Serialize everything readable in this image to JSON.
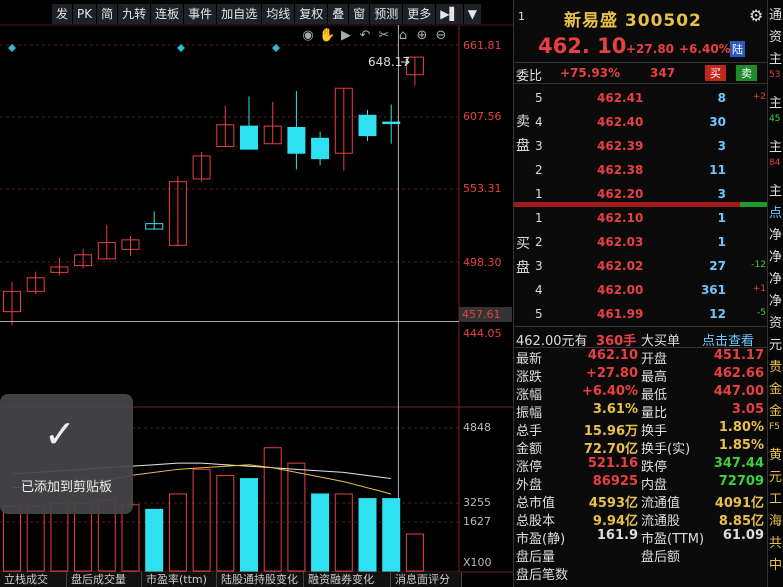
{
  "toolbar": {
    "items": [
      "发",
      "PK",
      "简",
      "九转",
      "连板",
      "事件",
      "加自选",
      "均线",
      "复权",
      "叠",
      "窗",
      "预测",
      "更多",
      "▶▌",
      "▼"
    ]
  },
  "chart_icons": [
    "eye-icon",
    "hand-icon",
    "play-icon",
    "undo-icon",
    "scissors-icon",
    "lock-icon",
    "zoom-in-icon",
    "zoom-out-icon"
  ],
  "chart_data": [
    {
      "type": "candlestick",
      "y_ticks": [
        "661.81",
        "607.56",
        "553.31",
        "498.30",
        "444.05"
      ],
      "ylim": [
        435.2,
        673.0
      ],
      "annotations": {
        "high_label": "648.17",
        "current_price_label": "457.61"
      },
      "up_color": "#e84040",
      "down_color": "#2ee0f0",
      "candles": [
        {
          "o": 465.0,
          "h": 487.0,
          "l": 455.0,
          "c": 480.0
        },
        {
          "o": 480.0,
          "h": 494.5,
          "l": 478.0,
          "c": 490.0
        },
        {
          "o": 494.0,
          "h": 505.0,
          "l": 492.0,
          "c": 498.0
        },
        {
          "o": 499.0,
          "h": 511.5,
          "l": 497.0,
          "c": 507.0
        },
        {
          "o": 504.0,
          "h": 529.0,
          "l": 504.0,
          "c": 516.0
        },
        {
          "o": 511.0,
          "h": 521.0,
          "l": 506.0,
          "c": 518.0
        },
        {
          "o": 530.0,
          "h": 539.0,
          "l": 527.0,
          "c": 526.0
        },
        {
          "o": 514.0,
          "h": 565.0,
          "l": 513.0,
          "c": 561.0
        },
        {
          "o": 563.0,
          "h": 583.0,
          "l": 561.0,
          "c": 580.0
        },
        {
          "o": 587.0,
          "h": 617.0,
          "l": 587.0,
          "c": 603.0
        },
        {
          "o": 602.0,
          "h": 624.0,
          "l": 593.0,
          "c": 585.0
        },
        {
          "o": 589.0,
          "h": 620.0,
          "l": 589.0,
          "c": 602.0
        },
        {
          "o": 601.0,
          "h": 628.0,
          "l": 570.0,
          "c": 582.0
        },
        {
          "o": 593.0,
          "h": 598.0,
          "l": 573.0,
          "c": 578.0
        },
        {
          "o": 582.0,
          "h": 588.0,
          "l": 569.0,
          "c": 630.0
        },
        {
          "o": 610.0,
          "h": 614.0,
          "l": 591.0,
          "c": 595.0
        },
        {
          "o": 605.0,
          "h": 618.0,
          "l": 589.0,
          "c": 604.0
        },
        {
          "o": 640.0,
          "h": 649.0,
          "l": 632.0,
          "c": 653.0
        }
      ],
      "candle_fill": [
        false,
        false,
        false,
        false,
        false,
        false,
        false,
        false,
        false,
        false,
        true,
        false,
        true,
        true,
        false,
        true,
        true,
        false
      ]
    },
    {
      "type": "bar",
      "y_ticks": [
        "4848",
        "3255",
        "1627"
      ],
      "x_tick": "X100",
      "ylim": [
        0,
        5225
      ],
      "values": [
        2100,
        2100,
        2200,
        2200,
        2300,
        2150,
        2000,
        2500,
        3300,
        3100,
        3000,
        4000,
        3500,
        2500,
        2500,
        2350,
        2350,
        1200
      ],
      "colors": [
        "#e84040",
        "#e84040",
        "#e84040",
        "#e84040",
        "#e84040",
        "#e84040",
        "#2ee0f0",
        "#e84040",
        "#e84040",
        "#e84040",
        "#2ee0f0",
        "#e84040",
        "#e84040",
        "#2ee0f0",
        "#e84040",
        "#2ee0f0",
        "#2ee0f0",
        "#e84040"
      ],
      "bar_fill": [
        false,
        false,
        false,
        false,
        false,
        false,
        true,
        false,
        false,
        false,
        true,
        false,
        false,
        true,
        false,
        true,
        true,
        false
      ],
      "ma_white": [
        3150,
        3200,
        3250,
        3300,
        3350,
        3400,
        3450,
        3500,
        3500,
        3450,
        3400,
        3350,
        3300,
        3250,
        3200,
        3100,
        3000
      ],
      "ma_yellow": [
        2700,
        2750,
        2800,
        2850,
        2950,
        3100,
        3200,
        3300,
        3350,
        3400,
        3450,
        3350,
        3200,
        3050,
        2900,
        2700,
        2500
      ]
    }
  ],
  "bottom_tabs": [
    "立栈成交",
    "盘后成交量",
    "市盈率(ttm)",
    "陆股通持股变化",
    "融资融券变化",
    "消息面评分"
  ],
  "toast": {
    "message": "已添加到剪贴板"
  },
  "stock": {
    "name": "新易盛 300502",
    "index_mark": "1",
    "price": "462. 10",
    "change": "+27.80",
    "change_pct": "+6.40%",
    "flag": "陆"
  },
  "weibi": {
    "label": "委比",
    "value": "+75.93%",
    "diff": "347",
    "buy": "买",
    "sell": "卖"
  },
  "sell_label": [
    "卖",
    "盘"
  ],
  "buy_label": [
    "买",
    "盘"
  ],
  "asks": [
    {
      "level": "5",
      "price": "462.41",
      "vol": "8",
      "chg": "+2",
      "chg_color": "#e84040"
    },
    {
      "level": "4",
      "price": "462.40",
      "vol": "30",
      "chg": "",
      "chg_color": "#e84040"
    },
    {
      "level": "3",
      "price": "462.39",
      "vol": "3",
      "chg": "",
      "chg_color": "#e84040"
    },
    {
      "level": "2",
      "price": "462.38",
      "vol": "11",
      "chg": "",
      "chg_color": "#e84040"
    },
    {
      "level": "1",
      "price": "462.20",
      "vol": "3",
      "chg": "",
      "chg_color": "#e84040"
    }
  ],
  "bids": [
    {
      "level": "1",
      "price": "462.10",
      "vol": "1",
      "chg": "",
      "chg_color": "#e84040"
    },
    {
      "level": "2",
      "price": "462.03",
      "vol": "1",
      "chg": "",
      "chg_color": "#e84040"
    },
    {
      "level": "3",
      "price": "462.02",
      "vol": "27",
      "chg": "-12",
      "chg_color": "#3dd13d"
    },
    {
      "level": "4",
      "price": "462.00",
      "vol": "361",
      "chg": "+1",
      "chg_color": "#e84040"
    },
    {
      "level": "5",
      "price": "461.99",
      "vol": "12",
      "chg": "-5",
      "chg_color": "#3dd13d"
    }
  ],
  "last_trade": {
    "price": "462.00元有",
    "vol": "360手",
    "type": "大买单",
    "link": "点击查看"
  },
  "stats": [
    {
      "l1": "最新",
      "v1": "462.10",
      "c1": "#e84040",
      "l2": "开盘",
      "v2": "451.17",
      "c2": "#e84040"
    },
    {
      "l1": "涨跌",
      "v1": "+27.80",
      "c1": "#e84040",
      "l2": "最高",
      "v2": "462.66",
      "c2": "#e84040"
    },
    {
      "l1": "涨幅",
      "v1": "+6.40%",
      "c1": "#e84040",
      "l2": "最低",
      "v2": "447.00",
      "c2": "#e84040"
    },
    {
      "l1": "振幅",
      "v1": "3.61%",
      "c1": "#e8c04a",
      "l2": "量比",
      "v2": "3.05",
      "c2": "#e84040"
    },
    {
      "l1": "总手",
      "v1": "15.96万",
      "c1": "#e8c04a",
      "l2": "换手",
      "v2": "1.80%",
      "c2": "#e8c04a"
    },
    {
      "l1": "金额",
      "v1": "72.70亿",
      "c1": "#e8c04a",
      "l2": "换手(实)",
      "v2": "1.85%",
      "c2": "#e8c04a"
    },
    {
      "l1": "涨停",
      "v1": "521.16",
      "c1": "#e84040",
      "l2": "跌停",
      "v2": "347.44",
      "c2": "#3dd13d"
    },
    {
      "l1": "外盘",
      "v1": "86925",
      "c1": "#e84040",
      "l2": "内盘",
      "v2": "72709",
      "c2": "#3dd13d"
    },
    {
      "l1": "总市值",
      "v1": "4593亿",
      "c1": "#e8c04a",
      "l2": "流通值",
      "v2": "4091亿",
      "c2": "#e8c04a"
    },
    {
      "l1": "总股本",
      "v1": "9.94亿",
      "c1": "#e8c04a",
      "l2": "流通股",
      "v2": "8.85亿",
      "c2": "#e8c04a"
    },
    {
      "l1": "市盈(静)",
      "v1": "161.9",
      "c1": "#dddddd",
      "l2": "市盈(TTM)",
      "v2": "61.09",
      "c2": "#dddddd"
    },
    {
      "l1": "盘后量",
      "v1": "",
      "c1": "#dddddd",
      "l2": "盘后额",
      "v2": "",
      "c2": "#dddddd"
    },
    {
      "l1": "盘后笔数",
      "v1": "",
      "c1": "#dddddd",
      "l2": "",
      "v2": "",
      "c2": "#dddddd"
    }
  ],
  "right_strip": [
    {
      "t": "通",
      "c": "#ddd"
    },
    {
      "t": "资",
      "c": "#ddd"
    },
    {
      "t": "主",
      "c": "#ddd"
    },
    {
      "t": "53",
      "c": "#e84040"
    },
    {
      "t": "主",
      "c": "#ddd"
    },
    {
      "t": "45",
      "c": "#3dd13d"
    },
    {
      "t": "主",
      "c": "#ddd"
    },
    {
      "t": "84",
      "c": "#e84040"
    },
    {
      "t": "主",
      "c": "#ddd"
    },
    {
      "t": "点",
      "c": "#6ec8ff"
    },
    {
      "t": "净",
      "c": "#ddd"
    },
    {
      "t": "净",
      "c": "#ddd"
    },
    {
      "t": "净",
      "c": "#ddd"
    },
    {
      "t": "净",
      "c": "#ddd"
    },
    {
      "t": "资",
      "c": "#ddd"
    },
    {
      "t": "元",
      "c": "#ddd"
    },
    {
      "t": "贵",
      "c": "#e8c04a"
    },
    {
      "t": "金",
      "c": "#e8c04a"
    },
    {
      "t": "金",
      "c": "#e8c04a"
    },
    {
      "t": "F5",
      "c": "#e8c04a"
    },
    {
      "t": "黄",
      "c": "#e8c04a"
    },
    {
      "t": "元",
      "c": "#e8c04a"
    },
    {
      "t": "工",
      "c": "#e8c04a"
    },
    {
      "t": "海",
      "c": "#e8c04a"
    },
    {
      "t": "共",
      "c": "#e8c04a"
    },
    {
      "t": "中",
      "c": "#e8c04a"
    }
  ]
}
